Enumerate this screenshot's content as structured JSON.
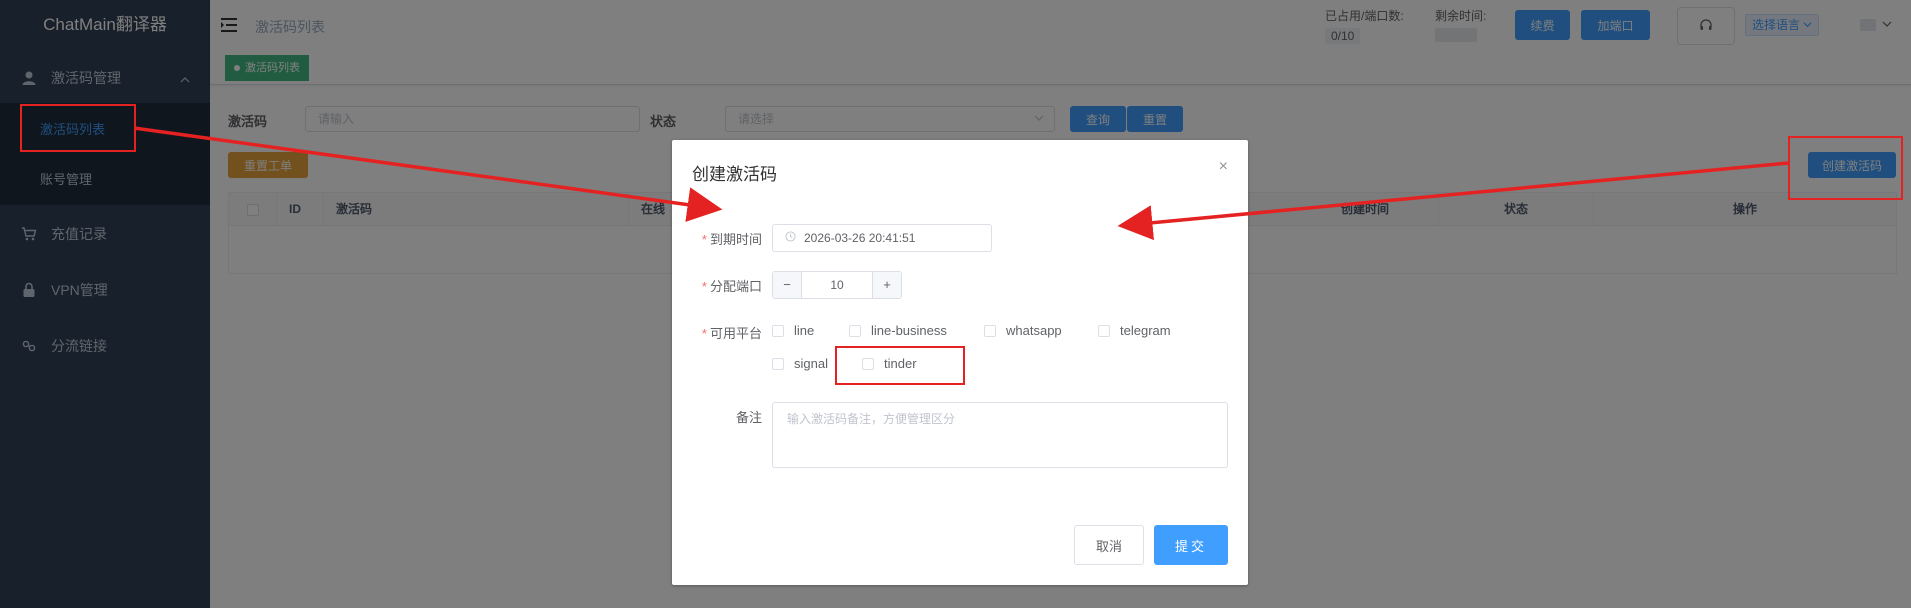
{
  "sidebar": {
    "brand": "ChatMain翻译器",
    "menu": {
      "activation": {
        "label": "激活码管理",
        "icon": "user-icon"
      },
      "recharge": {
        "label": "充值记录",
        "icon": "cart-icon"
      },
      "vpn": {
        "label": "VPN管理",
        "icon": "lock-icon"
      },
      "split": {
        "label": "分流链接",
        "icon": "link-icon"
      }
    },
    "submenu": {
      "list": "激活码列表",
      "account": "账号管理"
    }
  },
  "navbar": {
    "breadcrumb": "激活码列表",
    "port_label": "已占用/端口数:",
    "port_value": "0/10",
    "time_label": "剩余时间:",
    "renew": "续费",
    "add_port": "加端口",
    "language": "选择语言"
  },
  "tags": {
    "active": "激活码列表"
  },
  "search": {
    "code_label": "激活码",
    "code_placeholder": "请输入",
    "status_label": "状态",
    "status_placeholder": "请选择",
    "query": "查询",
    "reset": "重置"
  },
  "actions": {
    "reset_ticket": "重置工单",
    "create": "创建激活码"
  },
  "table": {
    "columns": {
      "id": "ID",
      "code": "激活码",
      "online": "在线",
      "created": "创建时间",
      "status": "状态",
      "ops": "操作"
    }
  },
  "dialog": {
    "title": "创建激活码",
    "expire_label": "到期时间",
    "expire_value": "2026-03-26 20:41:51",
    "port_label": "分配端口",
    "port_value": "10",
    "platform_label": "可用平台",
    "platforms": [
      "line",
      "line-business",
      "whatsapp",
      "telegram",
      "signal",
      "tinder"
    ],
    "remark_label": "备注",
    "remark_placeholder": "输入激活码备注，方便管理区分",
    "cancel": "取消",
    "submit": "提交",
    "minus": "−",
    "plus": "+",
    "close": "×"
  },
  "colors": {
    "sidebar_bg": "#304156",
    "accent": "#409eff",
    "annotation": "#e52222"
  }
}
